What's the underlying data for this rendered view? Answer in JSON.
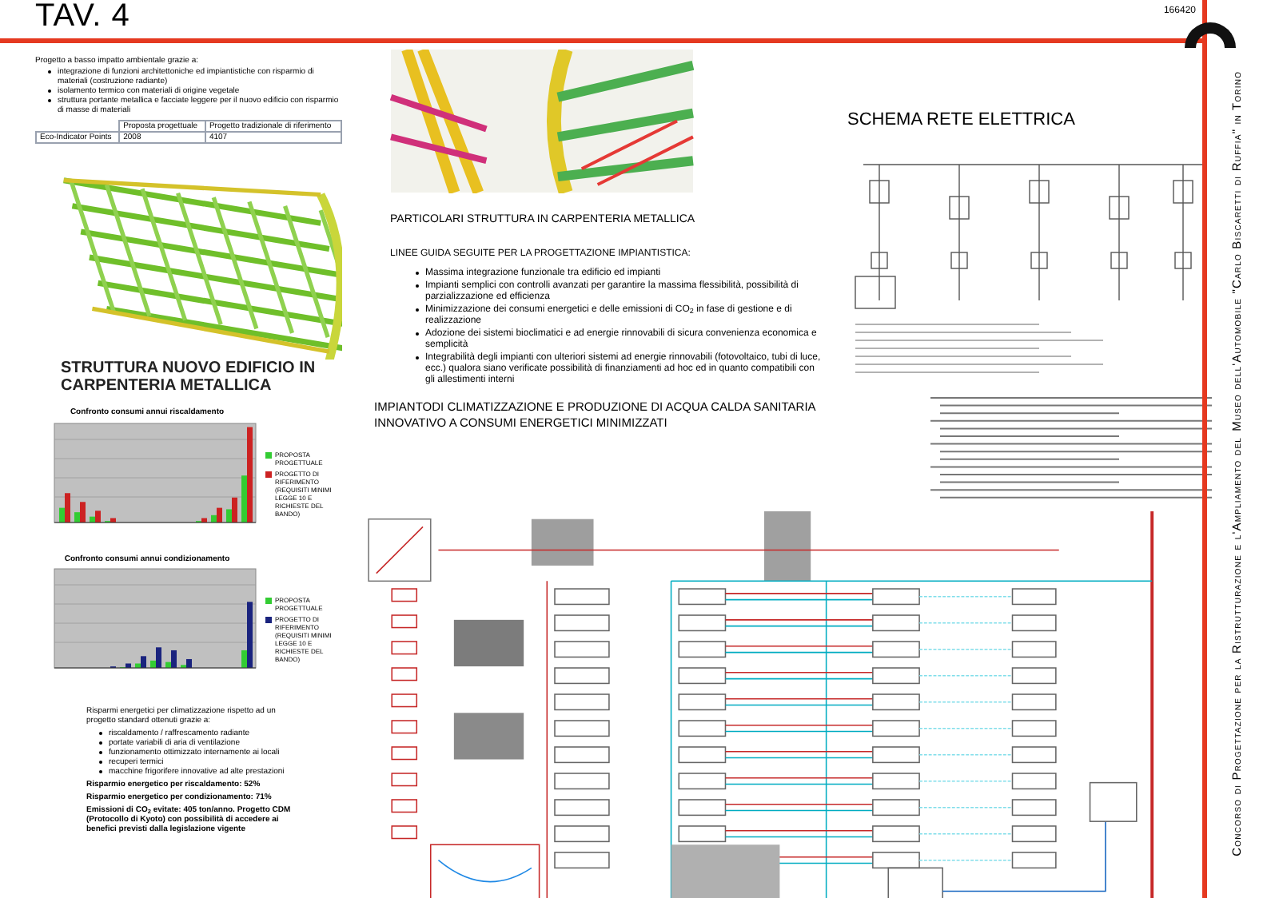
{
  "header": {
    "title": "TAV. 4",
    "code": "166420"
  },
  "side_title": {
    "lines": [
      "Concorso di Progettazione per la Ristrutturazione e l'Ampliamento del",
      "Museo dell'Automobile \"Carlo Biscaretti di Ruffia\" in Torino"
    ]
  },
  "intro": {
    "lead": "Progetto a basso impatto ambientale grazie a:",
    "bullets": [
      "integrazione di funzioni architettoniche ed impiantistiche con risparmio di materiali (costruzione radiante)",
      "isolamento termico con materiali di origine vegetale",
      "struttura portante metallica e facciate leggere per il nuovo edificio con risparmio di masse di materiali"
    ],
    "table": {
      "columns": [
        "Proposta progettuale",
        "Progetto tradizionale di riferimento"
      ],
      "rows": [
        {
          "label": "Eco-Indicator Points",
          "cells": [
            "2008",
            "4107"
          ]
        }
      ]
    }
  },
  "structure_caption": "STRUTTURA NUOVO EDIFICIO IN CARPENTERIA METALLICA",
  "details_caption": "PARTICOLARI STRUTTURA IN CARPENTERIA METALLICA",
  "guidelines": {
    "title": "LINEE GUIDA SEGUITE PER LA PROGETTAZIONE IMPIANTISTICA:",
    "bullets": [
      "Massima integrazione funzionale tra edificio ed impianti",
      "Impianti semplici con controlli avanzati per garantire la massima flessibilità, possibilità di parzializzazione ed efficienza",
      "Minimizzazione dei consumi energetici e delle emissioni di CO$_{2}$ in fase di gestione e di realizzazione",
      "Adozione dei sistemi bioclimatici e ad energie rinnovabili di sicura convenienza economica e semplicità",
      "Integrabilità degli impianti con ulteriori sistemi ad energie rinnovabili (fotovoltaico, tubi di luce, ecc.) qualora siano verificate possibilità di finanziamenti ad hoc ed in quanto compatibili con gli allestimenti interni"
    ]
  },
  "electric_schema": {
    "title": "SCHEMA RETE ELETTRICA"
  },
  "charts": [
    {
      "kind": "heating",
      "title": "Confronto consumi annui riscaldamento",
      "legend": [
        {
          "label": "PROPOSTA PROGETTUALE",
          "color": "#33cc33"
        },
        {
          "label": "PROGETTO DI RIFERIMENTO (REQUISITI MINIMI LEGGE 10 E RICHIESTE DEL BANDO)",
          "color": "#cc2222"
        }
      ]
    },
    {
      "kind": "cooling",
      "title": "Confronto consumi annui condizionamento",
      "legend": [
        {
          "label": "PROPOSTA PROGETTUALE",
          "color": "#33cc33"
        },
        {
          "label": "PROGETTO DI RIFERIMENTO (REQUISITI MINIMI LEGGE 10 E RICHIESTE DEL BANDO)",
          "color": "#1a237e"
        }
      ]
    }
  ],
  "savings": {
    "lead": "Risparmi energetici per climatizzazione rispetto ad un progetto standard ottenuti grazie a:",
    "bullets": [
      "riscaldamento / raffrescamento radiante",
      "portate variabili di aria di ventilazione",
      "funzionamento ottimizzato internamente ai locali",
      "recuperi termici",
      "macchine frigorifere innovative ad alte prestazioni"
    ],
    "results": [
      "Risparmio energetico per riscaldamento: 52%",
      "Risparmio energetico per condizionamento: 71%"
    ],
    "emissions": "Emissioni di CO$_{2}$ evitate: 405 ton/anno. Progetto CDM (Protocollo di Kyoto) con possibilità di accedere ai benefici previsti dalla legislazione vigente"
  },
  "plant": {
    "title_lines": [
      "IMPIANTODI CLIMATIZZAZIONE E PRODUZIONE DI ACQUA CALDA SANITARIA",
      "INNOVATIVO A CONSUMI ENERGETICI MINIMIZZATI"
    ]
  }
}
